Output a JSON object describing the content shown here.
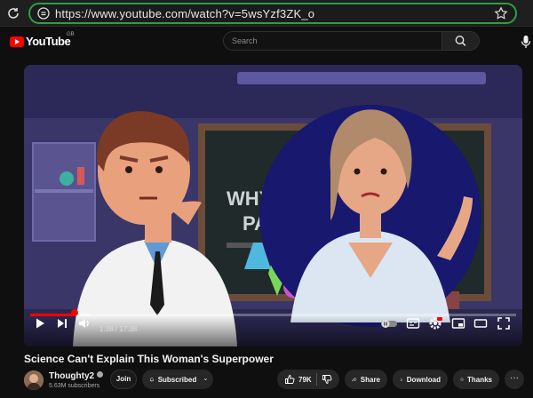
{
  "browser": {
    "url": "https://www.youtube.com/watch?v=5wsYzf3ZK_o"
  },
  "header": {
    "logo_text": "YouTube",
    "country_code": "GB",
    "search_placeholder": "Search"
  },
  "player": {
    "time_current": "1:38",
    "time_total": "17:38",
    "time_display": "1:38 / 17:38",
    "played_fraction": 0.092,
    "buffered_fraction": 0.125,
    "progress_color": "#ff0000",
    "scene_text_top": "WHY",
    "scene_text_bottom": "PAI"
  },
  "video": {
    "title": "Science Can't Explain This Woman's Superpower"
  },
  "channel": {
    "name": "Thoughty2",
    "subscribers": "5.63M subscribers",
    "join_label": "Join",
    "subscribed_label": "Subscribed"
  },
  "actions": {
    "likes": "79K",
    "share": "Share",
    "download": "Download",
    "thanks": "Thanks",
    "more": "···"
  },
  "colors": {
    "address_border": "#2e9e46",
    "accent": "#ff0000"
  }
}
